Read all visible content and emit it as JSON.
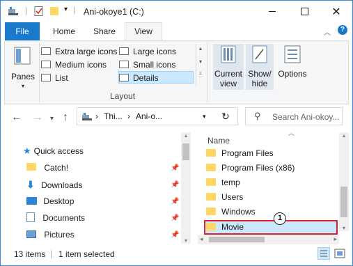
{
  "window": {
    "title": "Ani-okoye1 (C:)"
  },
  "ribbon_tabs": [
    "File",
    "Home",
    "Share",
    "View"
  ],
  "ribbon": {
    "panes_label": "Panes",
    "layout_items": {
      "extra_large": "Extra large icons",
      "large": "Large icons",
      "medium": "Medium icons",
      "small": "Small icons",
      "list": "List",
      "details": "Details"
    },
    "layout_caption": "Layout",
    "current_view": "Current view",
    "show_hide": "Show/ hide",
    "options": "Options"
  },
  "address": {
    "crumb1": "Thi...",
    "crumb2": "Ani-o..."
  },
  "search": {
    "placeholder": "Search Ani-okoy..."
  },
  "nav_pane": {
    "quick_access": "Quick access",
    "items": [
      "Catch!",
      "Downloads",
      "Desktop",
      "Documents",
      "Pictures"
    ]
  },
  "content": {
    "column_header": "Name",
    "rows": [
      "Program Files",
      "Program Files (x86)",
      "temp",
      "Users",
      "Windows",
      "Movie"
    ],
    "selected_row": "Movie",
    "callout_number": "1"
  },
  "status_bar": {
    "items_count": "13 items",
    "selected": "1 item selected"
  },
  "colors": {
    "accent": "#1979ca",
    "selection": "#cce8ff",
    "highlight_border": "#e0202a",
    "folder": "#ffd766"
  }
}
